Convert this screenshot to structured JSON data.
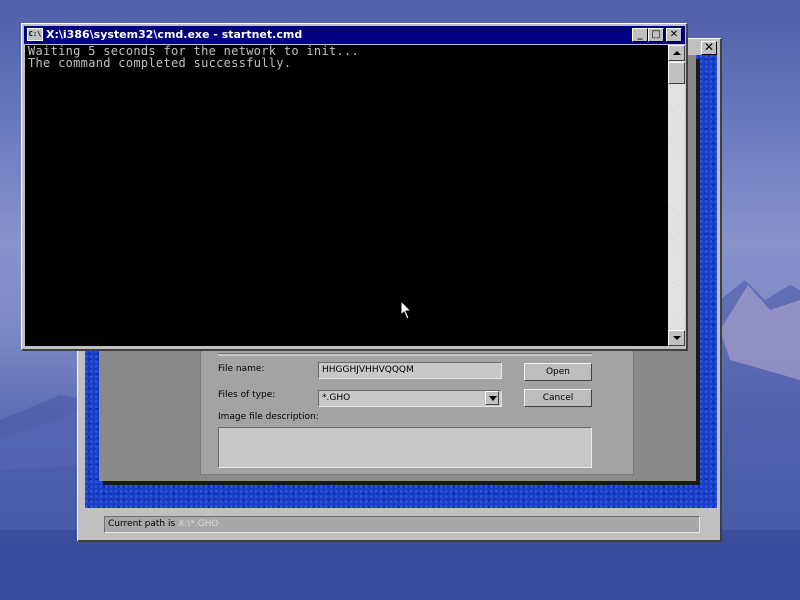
{
  "cmd_window": {
    "title": "X:\\i386\\system32\\cmd.exe - startnet.cmd",
    "icon_label": "C:\\",
    "controls": {
      "minimize": "_",
      "maximize": "□",
      "close": "✕"
    },
    "console_lines": [
      "Waiting 5 seconds for the network to init...",
      "The command completed successfully."
    ]
  },
  "ghost_window": {
    "close": "✕",
    "dialog": {
      "file_name_label": "File name:",
      "file_name_value": "HHGGHJVHHVQQQM",
      "files_of_type_label": "Files of type:",
      "files_of_type_value": "*.GHO",
      "description_label": "Image file description:",
      "open_button": "Open",
      "cancel_button": "Cancel"
    },
    "status": {
      "label": "Current path is",
      "path": "X:\\*.GHO"
    }
  }
}
